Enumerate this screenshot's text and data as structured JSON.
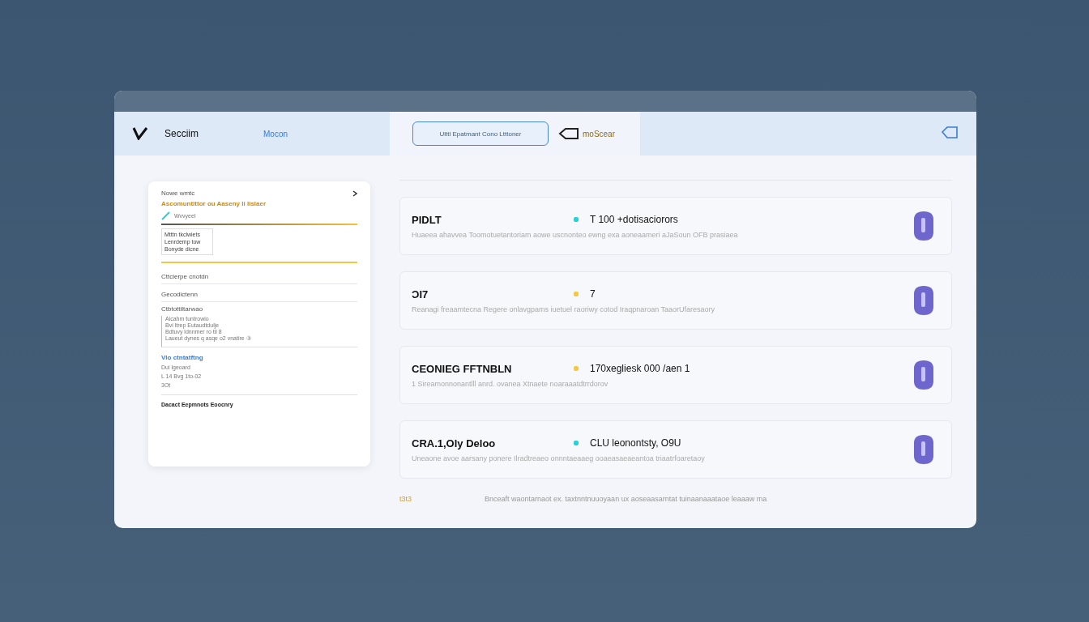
{
  "header": {
    "nav": [
      {
        "label": "Secciim",
        "selected": false
      },
      {
        "label": "Mocon",
        "selected": true
      }
    ],
    "action_button": "Ulttl Epatmant Cono Ltttoner",
    "brand": "moScear"
  },
  "side_panel": {
    "title": "Nowe wmtc",
    "highlight": "Ascomuntittor ou Aaseny li lislaer",
    "note": "Wvvyeel",
    "box_lines": [
      "Mtttn tkclwiets",
      "Lenrdemp tow",
      "Bonyde dicne"
    ],
    "items": [
      "Cttcierpe cnotdn",
      "Gecodictenn"
    ],
    "quote_title": "Ctbtottiltarwao",
    "quote_lines": [
      "Aicahm tuntrowio",
      "Bvi ltrep Eutaudtdulje",
      "Bdtuvy ldnnmer ro tii 8",
      "Laueut dynes q asqe o2 vnatire ③"
    ],
    "section_heading": "Vlo ctntatftng",
    "section_lines": [
      "Dui lgeoard",
      "L 14 Bvg 1to-02",
      "3Ot"
    ],
    "footer": "Dacact Eepmnots Eoocnry"
  },
  "rows": [
    {
      "title": "PIDLT",
      "color": "#2ad0d8",
      "value": "T  100 +dotisaciorors",
      "description": "Huaeea ahavvea Toomotuetantoriam aowe uscnonteo ewng exa aoneaameri aJaSoun OFB prasiaea"
    },
    {
      "title": "ϽI7",
      "color": "#f4c842",
      "value": "7",
      "description": "Reanagi freaamtecna Regere onlavgpams iuetuel raoriwy cotod Iraqpnaroan TaaorUfaresaory"
    },
    {
      "title": "CEONIEG FFTNBLN",
      "color": "#f4c842",
      "value": "170xegliesk 000 /aen 1",
      "description": "1 Sireamonnonantlll anrd. ovanea Xtnaete noaraaatdtrrdorov"
    },
    {
      "title": "CRA.1,Oly Deloo",
      "color": "#2ad0d8",
      "value": "CLU leonontsty, O9U",
      "description": "Uneaone avoe aarsany ponere Ilradtreaeo onnntaeaaeg ooaeasaeaeantoa triaatrfoaretaoy"
    }
  ],
  "footer_row": {
    "tag": "t3t3",
    "text": "Bnceaft waontarnaot ex. taxtnntnuuoyaan ux aoseaasarntat tuinaanaaataoe leaaaw ma"
  }
}
